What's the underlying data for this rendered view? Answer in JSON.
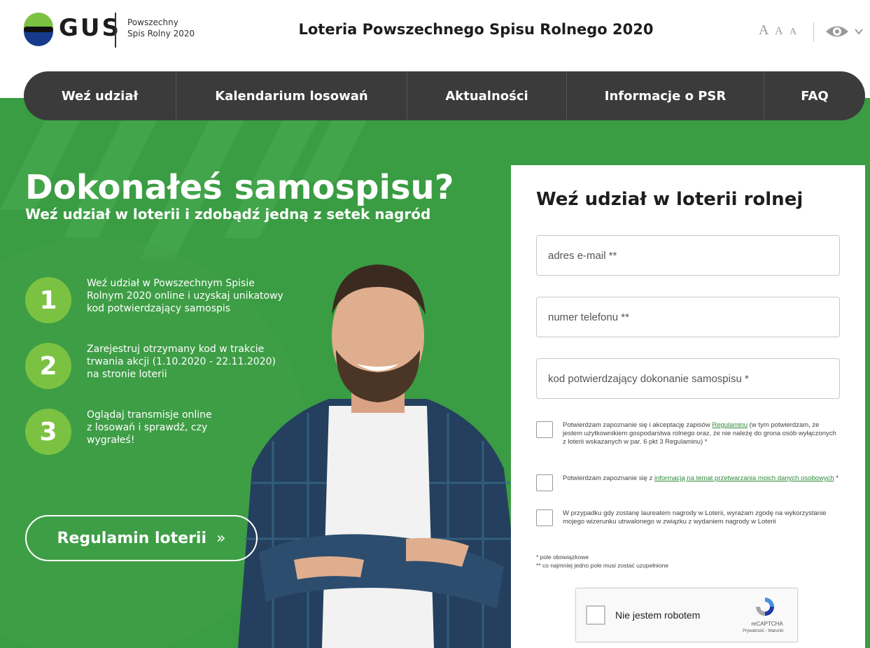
{
  "header": {
    "logo_text": "GUS",
    "sub_line1": "Powszechny",
    "sub_line2": "Spis Rolny 2020",
    "site_title": "Loteria Powszechnego Spisu Rolnego 2020",
    "font_sizes": [
      "A",
      "A",
      "A"
    ],
    "contrast_icon": "eye-icon"
  },
  "nav": {
    "items": [
      {
        "label": "Weź udział"
      },
      {
        "label": "Kalendarium losowań"
      },
      {
        "label": "Aktualności"
      },
      {
        "label": "Informacje o PSR"
      },
      {
        "label": "FAQ"
      }
    ]
  },
  "hero": {
    "title": "Dokonałeś samospisu?",
    "subtitle": "Weź udział w loterii i zdobądź jedną z setek nagród",
    "steps": [
      {
        "num": "1",
        "lines": [
          "Weź udział w Powszechnym Spisie",
          "Rolnym 2020 online i uzyskaj unikatowy",
          "kod potwierdzający samospis"
        ]
      },
      {
        "num": "2",
        "lines": [
          "Zarejestruj otrzymany kod w trakcie",
          "trwania akcji (1.10.2020 - 22.11.2020)",
          "na stronie loterii"
        ]
      },
      {
        "num": "3",
        "lines": [
          "Oglądaj transmisje online",
          "z losowań i sprawdź, czy",
          "wygrałeś!"
        ]
      }
    ],
    "regulamin_button": "Regulamin loterii",
    "regulamin_arrow": "»"
  },
  "form": {
    "title": "Weź udział w loterii rolnej",
    "email_placeholder": "adres e-mail **",
    "phone_placeholder": "numer telefonu **",
    "code_placeholder": "kod potwierdzający dokonanie samospisu *",
    "consent1_pre": "Potwierdzam zapoznanie się i akceptację zapisów ",
    "consent1_link": "Regulaminu",
    "consent1_post": " (w tym potwierdzam, że jestem użytkownikiem gospodarstwa rolnego oraz, że nie należę do grona osób wyłączonych z loterii wskazanych w par. 6 pkt 3 Regulaminu) *",
    "consent2_pre": "Potwierdzam zapoznanie się z ",
    "consent2_link": "informacją na temat przetwarzania moich danych osobowych",
    "consent2_post": " *",
    "consent3": "W przypadku gdy zostanę laureatem nagrody w Loterii, wyrażam zgodę na wykorzystanie mojego wizerunku utrwalonego w związku z wydaniem nagrody w Loterii",
    "note1": "* pole obowiązkowe",
    "note2": "** co najmniej jedno pole musi zostać uzupełnione",
    "captcha_label": "Nie jestem robotem",
    "captcha_brand": "reCAPTCHA",
    "captcha_terms": "Prywatność - Warunki"
  },
  "colors": {
    "green": "#3a9c43",
    "light_green": "#7cc242",
    "nav_dark": "#3b3b3b",
    "gus_blue": "#163a8c"
  }
}
